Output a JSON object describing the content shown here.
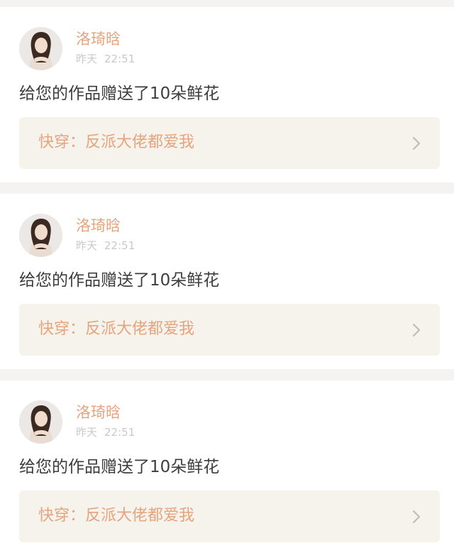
{
  "feed": {
    "items": [
      {
        "user": {
          "name": "洛琦晗"
        },
        "time": {
          "day": "昨天",
          "clock": "22:51"
        },
        "message": "给您的作品赠送了10朵鲜花",
        "book": {
          "title": "快穿：反派大佬都爱我"
        }
      },
      {
        "user": {
          "name": "洛琦晗"
        },
        "time": {
          "day": "昨天",
          "clock": "22:51"
        },
        "message": "给您的作品赠送了10朵鲜花",
        "book": {
          "title": "快穿：反派大佬都爱我"
        }
      },
      {
        "user": {
          "name": "洛琦晗"
        },
        "time": {
          "day": "昨天",
          "clock": "22:51"
        },
        "message": "给您的作品赠送了10朵鲜花",
        "book": {
          "title": "快穿：反派大佬都爱我"
        }
      }
    ]
  },
  "icons": {
    "avatar": "user-photo",
    "chevron": "chevron-right-icon"
  },
  "colors": {
    "page_background": "#f5f2f2",
    "card_background": "#ffffff",
    "accent": "#e5a47e",
    "message_text": "#3d3d3d",
    "timestamp_text": "#c9c9c9",
    "book_link_background": "#f5f3ec",
    "chevron": "#bdbdbd"
  }
}
